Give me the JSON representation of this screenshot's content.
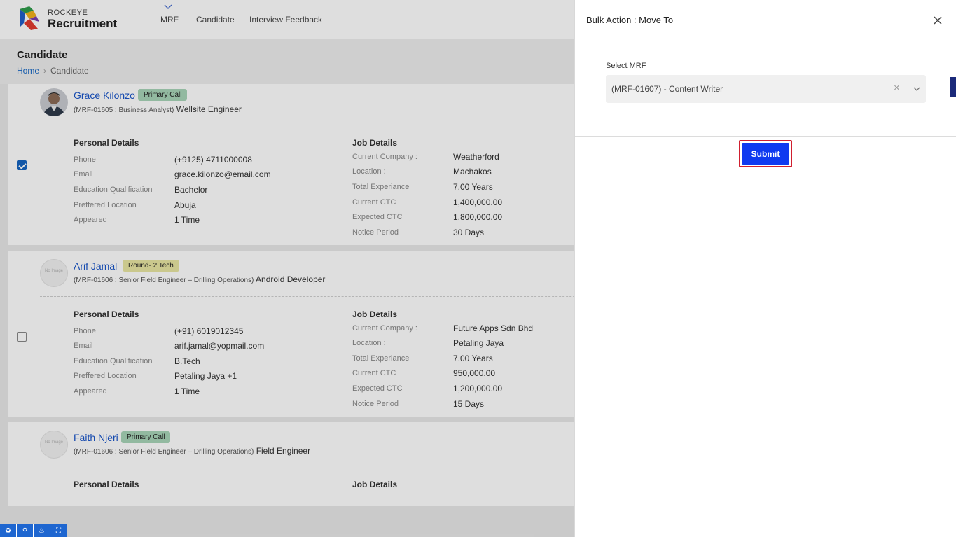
{
  "header": {
    "brand_top": "ROCKEYE",
    "brand_main": "Recruitment",
    "nav": [
      "MRF",
      "Candidate",
      "Interview Feedback"
    ]
  },
  "page": {
    "title": "Candidate",
    "breadcrumb": [
      "Home",
      "Candidate"
    ]
  },
  "labels": {
    "personal_details": "Personal Details",
    "job_details": "Job Details",
    "phone": "Phone",
    "email": "Email",
    "education": "Education Qualification",
    "preferred_location": "Preffered Location",
    "appeared": "Appeared",
    "current_company": "Current Company :",
    "location": "Location :",
    "total_experience": "Total Experiance",
    "current_ctc": "Current CTC",
    "expected_ctc": "Expected CTC",
    "notice_period": "Notice Period",
    "no_image": "No Image"
  },
  "candidates": [
    {
      "name": "Grace Kilonzo",
      "status": "Primary Call",
      "mrf": "(MRF-01605 : Business Analyst)",
      "role": "Wellsite Engineer",
      "checked": true,
      "phone": "(+9125) 4711000008",
      "email": "grace.kilonzo@email.com",
      "education": "Bachelor",
      "preferred_location": "Abuja",
      "appeared": "1 Time",
      "current_company": "Weatherford",
      "location": "Machakos",
      "total_experience": "7.00 Years",
      "current_ctc": "1,400,000.00",
      "expected_ctc": "1,800,000.00",
      "notice_period": "30 Days"
    },
    {
      "name": "Arif Jamal",
      "status": "Round- 2 Tech",
      "mrf": "(MRF-01606 : Senior Field Engineer – Drilling Operations)",
      "role": "Android Developer",
      "checked": false,
      "phone": "(+91) 6019012345",
      "email": "arif.jamal@yopmail.com",
      "education": "B.Tech",
      "preferred_location": "Petaling Jaya +1",
      "appeared": "1 Time",
      "current_company": "Future Apps Sdn Bhd",
      "location": "Petaling Jaya",
      "total_experience": "7.00 Years",
      "current_ctc": "950,000.00",
      "expected_ctc": "1,200,000.00",
      "notice_period": "15 Days"
    },
    {
      "name": "Faith Njeri",
      "status": "Primary Call",
      "mrf": "(MRF-01606 : Senior Field Engineer – Drilling Operations)",
      "role": "Field Engineer"
    }
  ],
  "drawer": {
    "title": "Bulk Action : Move To",
    "field_label": "Select MRF",
    "selected_value": "(MRF-01607) - Content Writer",
    "submit_label": "Submit"
  },
  "colors": {
    "primary": "#0f3af0",
    "link": "#1a56c9",
    "badge_primary_call": "#a8d5b8",
    "badge_round": "#e9e6a3",
    "highlight": "#d01f2f"
  }
}
